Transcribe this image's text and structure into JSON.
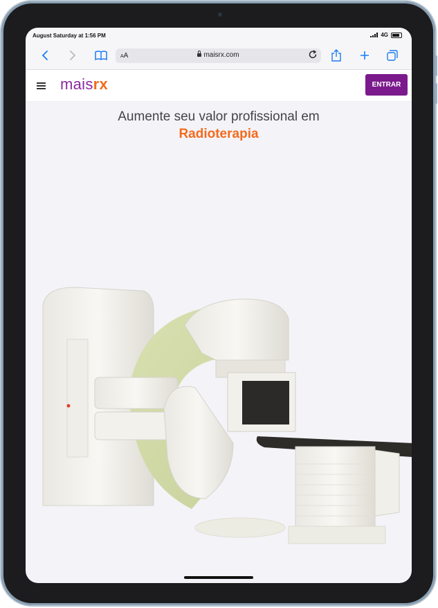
{
  "status_bar": {
    "time": "August Saturday at 1:56 PM",
    "network": "4G"
  },
  "browser": {
    "text_size_label": "AA",
    "url": "maisrx.com",
    "icons": [
      "back-icon",
      "forward-icon",
      "bookmarks-icon",
      "reload-icon",
      "share-icon",
      "new-tab-icon",
      "tabs-icon"
    ]
  },
  "site": {
    "logo": {
      "mais": "ma",
      "is": "is",
      "rx": "rx"
    },
    "login_button": "ENTRAR"
  },
  "hero": {
    "headline": "Aumente seu valor profissional em",
    "highlight": "Radioterapia",
    "image": "radiotherapy-machine"
  },
  "colors": {
    "brand_purple": "#7b1a8c",
    "brand_orange": "#f26b1d",
    "link_blue": "#1a7cf2"
  }
}
